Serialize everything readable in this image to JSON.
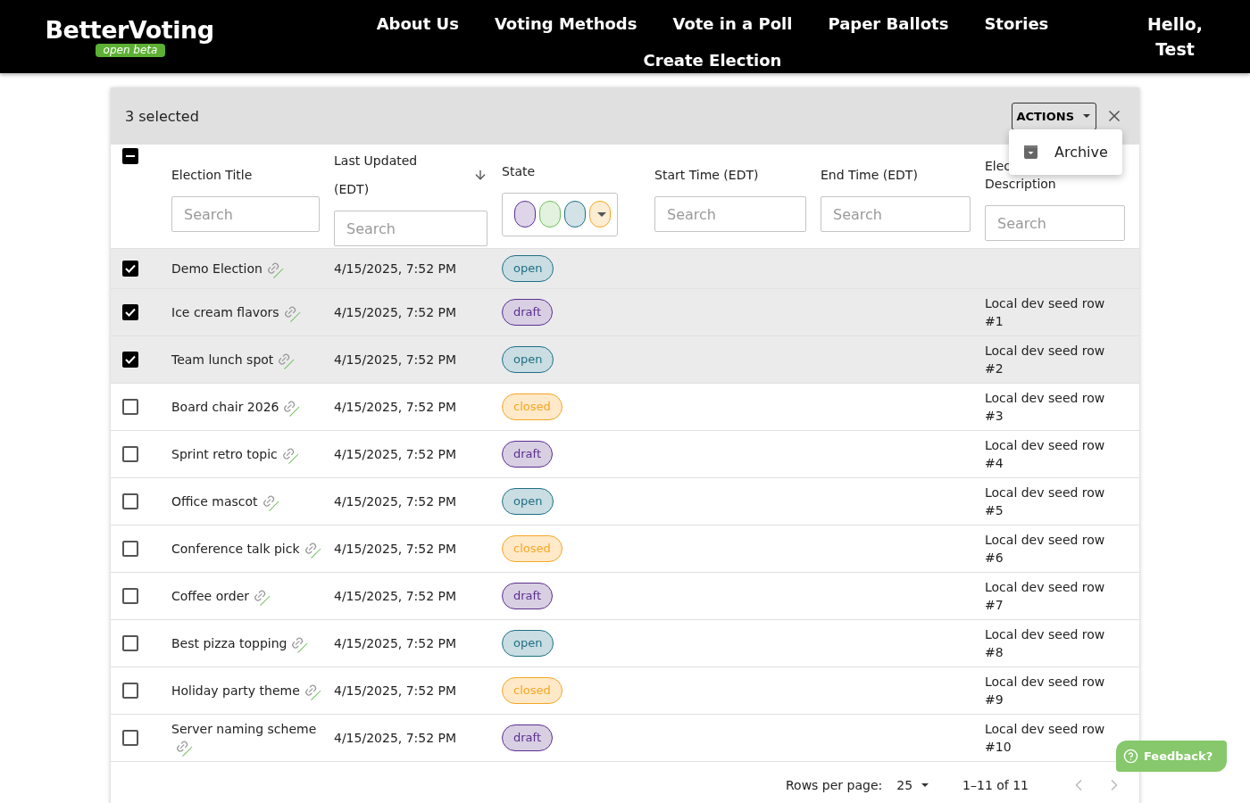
{
  "nav": {
    "logo": "BetterVoting",
    "logo_badge": "open beta",
    "links": [
      "About Us",
      "Voting Methods",
      "Vote in a Poll",
      "Paper Ballots",
      "Stories",
      "Create Election"
    ],
    "greeting": "Hello, Test"
  },
  "toolbar": {
    "selected_count": "3 selected",
    "actions_button": "ACTIONS",
    "menu_open": true,
    "menu_items": [
      "Archive"
    ]
  },
  "table": {
    "select_all": {
      "indeterminate": true
    },
    "columns": [
      {
        "kind": "text",
        "label": "Election Title",
        "placeholder": "Search"
      },
      {
        "kind": "text",
        "label": "Last Updated (EDT)",
        "placeholder": "Search",
        "sorted_descending": true
      },
      {
        "kind": "state",
        "label": "State",
        "chips": [
          {
            "color": "#5b2f8f"
          },
          {
            "color": "#6cbf5a"
          },
          {
            "color": "#1f6f85"
          },
          {
            "color": "#f5a623"
          }
        ]
      },
      {
        "kind": "text",
        "label": "Start Time (EDT)",
        "placeholder": "Search"
      },
      {
        "kind": "text",
        "label": "End Time (EDT)",
        "placeholder": "Search"
      },
      {
        "kind": "split",
        "label_parts": [
          "Elec",
          "Description"
        ],
        "placeholder": "Search"
      }
    ],
    "rows": [
      {
        "selected": true,
        "title": "Demo Election",
        "updated": "4/15/2025, 7:52 PM",
        "state": "open"
      },
      {
        "selected": true,
        "title": "Ice cream flavors",
        "updated": "4/15/2025, 7:52 PM",
        "state": "draft",
        "description": "Local dev seed row #1"
      },
      {
        "selected": true,
        "title": "Team lunch spot",
        "updated": "4/15/2025, 7:52 PM",
        "state": "open",
        "description": "Local dev seed row #2"
      },
      {
        "selected": false,
        "title": "Board chair 2026",
        "updated": "4/15/2025, 7:52 PM",
        "state": "closed",
        "description": "Local dev seed row #3"
      },
      {
        "selected": false,
        "title": "Sprint retro topic",
        "updated": "4/15/2025, 7:52 PM",
        "state": "draft",
        "description": "Local dev seed row #4"
      },
      {
        "selected": false,
        "title": "Office mascot",
        "updated": "4/15/2025, 7:52 PM",
        "state": "open",
        "description": "Local dev seed row #5"
      },
      {
        "selected": false,
        "title": "Conference talk pick",
        "updated": "4/15/2025, 7:52 PM",
        "state": "closed",
        "description": "Local dev seed row #6"
      },
      {
        "selected": false,
        "title": "Coffee order",
        "updated": "4/15/2025, 7:52 PM",
        "state": "draft",
        "description": "Local dev seed row #7"
      },
      {
        "selected": false,
        "title": "Best pizza topping",
        "updated": "4/15/2025, 7:52 PM",
        "state": "open",
        "description": "Local dev seed row #8"
      },
      {
        "selected": false,
        "title": "Holiday party theme",
        "updated": "4/15/2025, 7:52 PM",
        "state": "closed",
        "description": "Local dev seed row #9"
      },
      {
        "selected": false,
        "title": "Server naming scheme",
        "updated": "4/15/2025, 7:52 PM",
        "state": "draft",
        "description": "Local dev seed row #10"
      }
    ]
  },
  "pagination": {
    "rows_label": "Rows per page:",
    "rows_value": "25",
    "range": "1–11 of 11",
    "prev_disabled": true,
    "next_disabled": true
  },
  "feedback": "Feedback?"
}
